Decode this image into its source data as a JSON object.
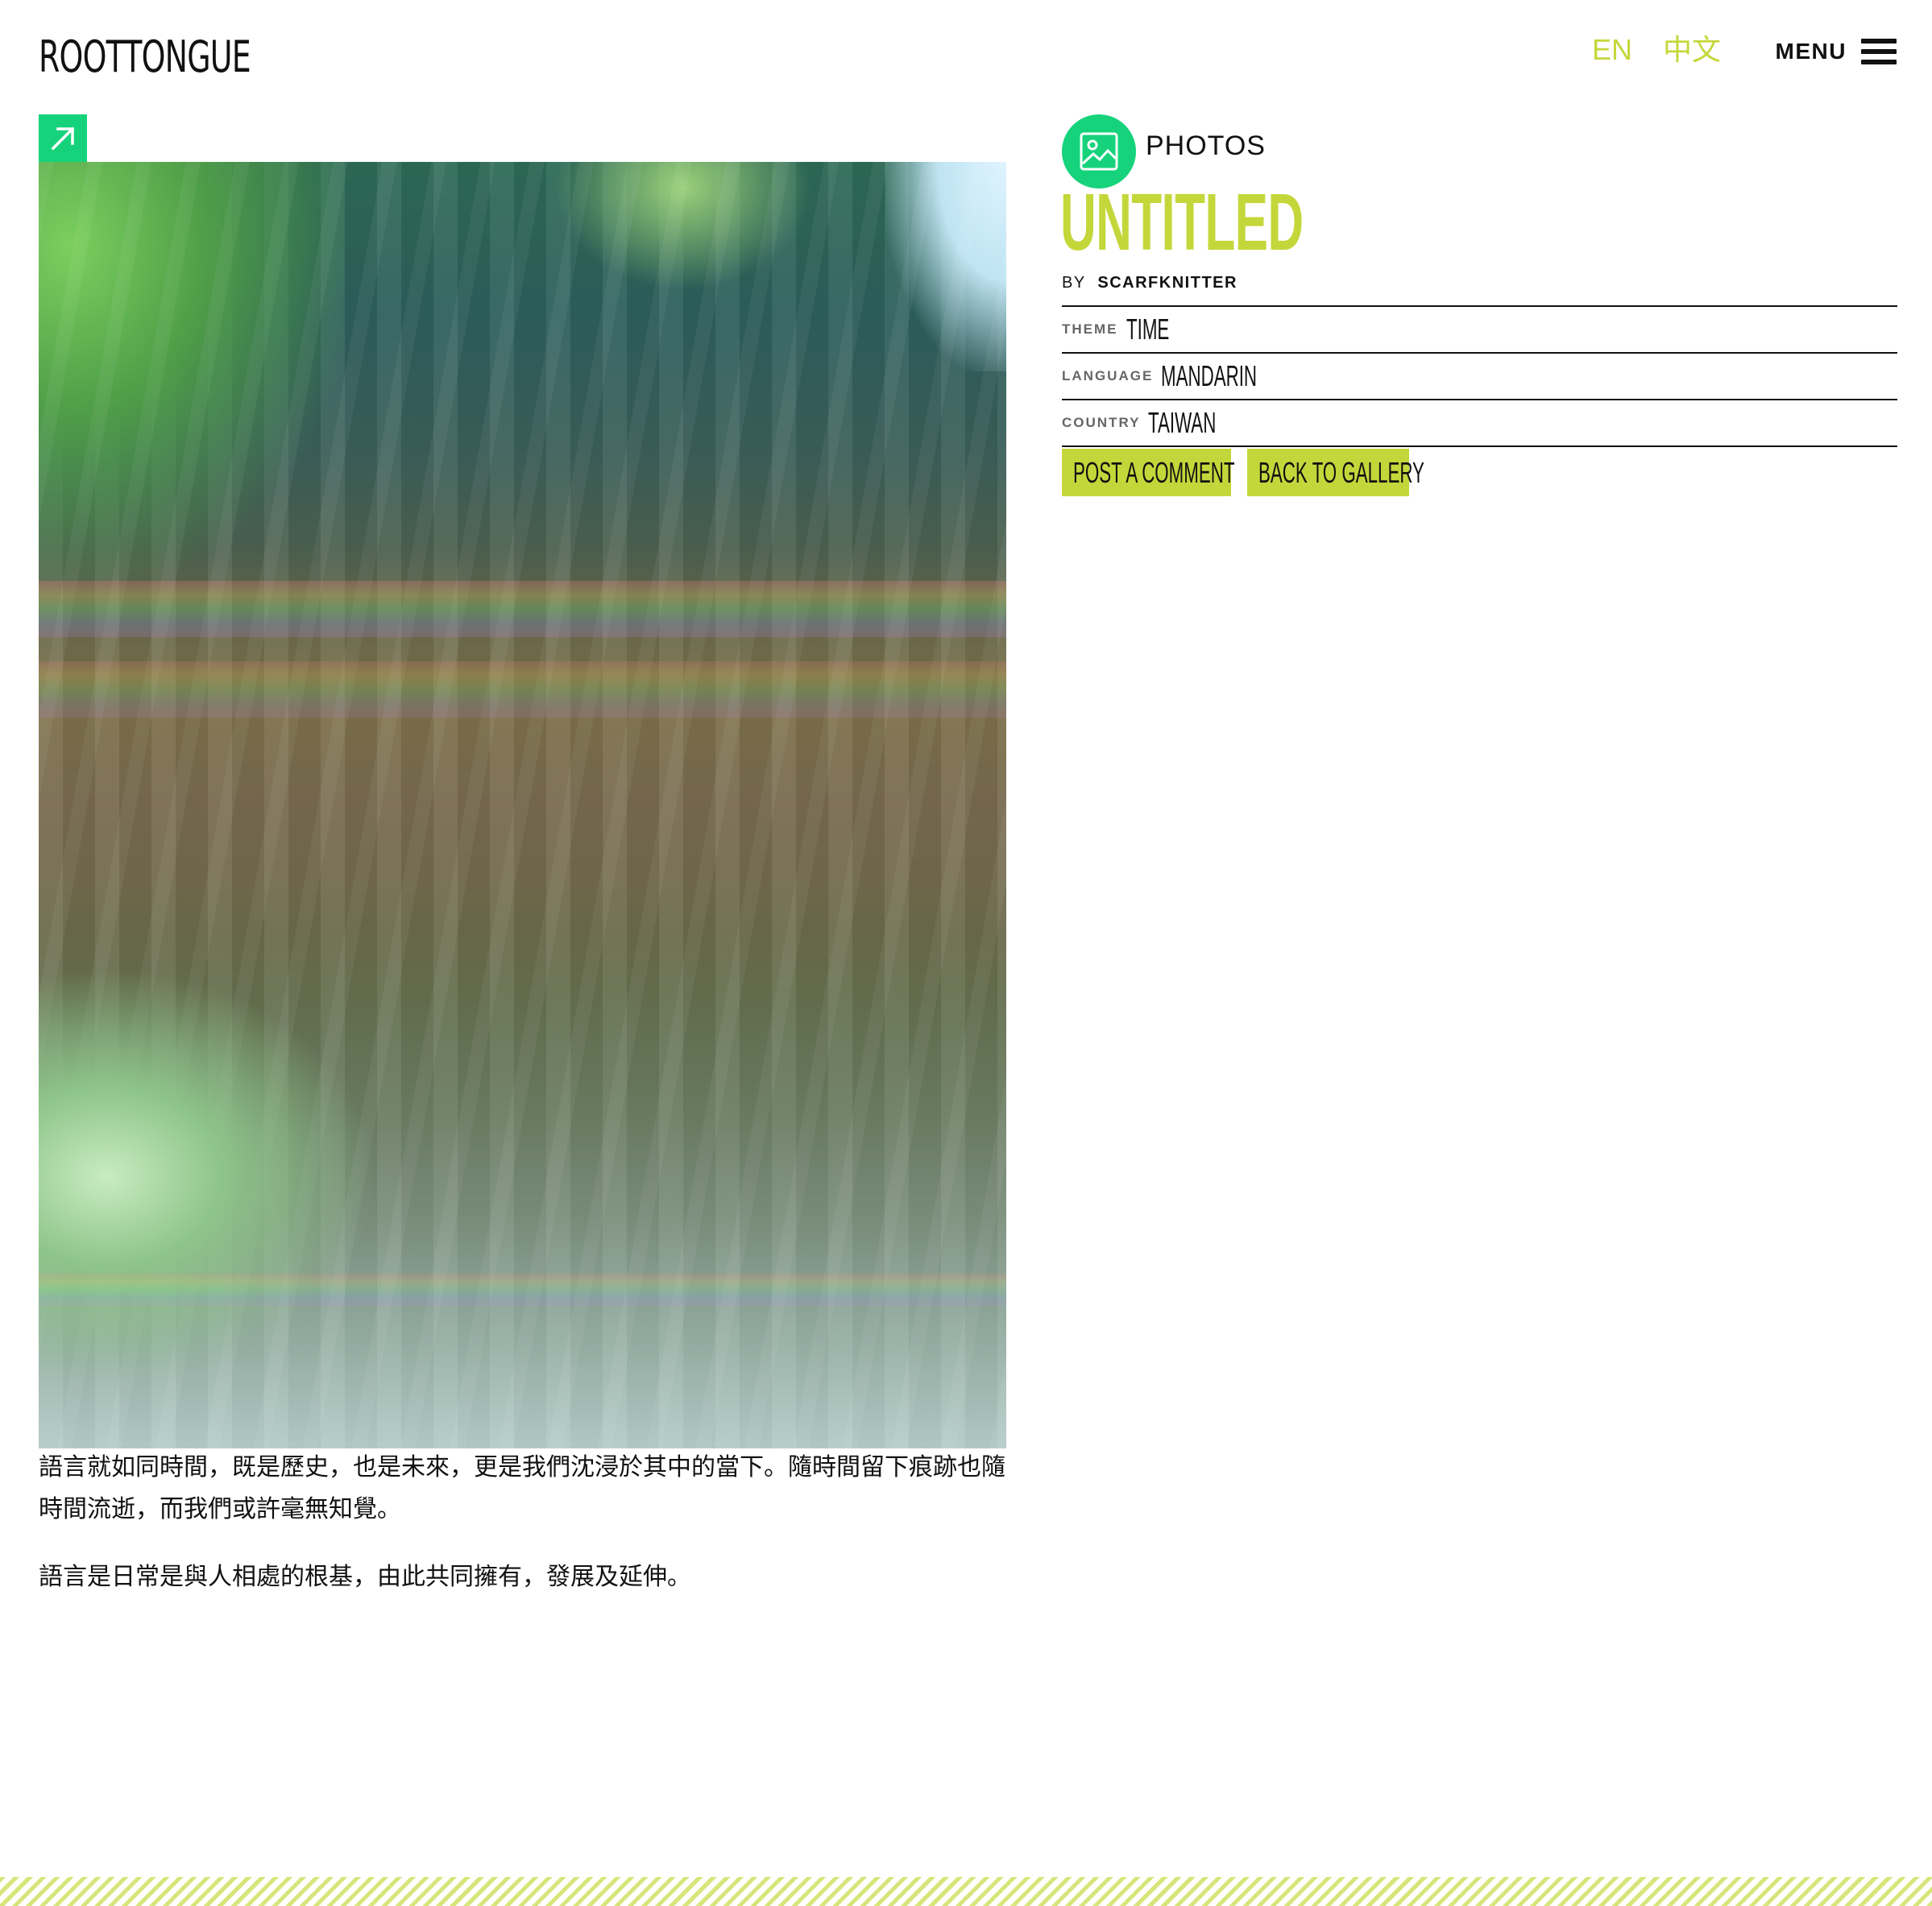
{
  "header": {
    "logo": "ROOTTONGUE",
    "languages": [
      "EN",
      "中文"
    ],
    "menu_label": "MENU"
  },
  "media": {
    "type_label": "PHOTOS",
    "type_icon": "image-icon",
    "expand_icon": "arrow-up-right-icon"
  },
  "entry": {
    "title": "UNTITLED",
    "by_label": "BY",
    "author": "SCARFKNITTER",
    "meta": [
      {
        "key": "THEME",
        "value": "TIME"
      },
      {
        "key": "LANGUAGE",
        "value": "MANDARIN"
      },
      {
        "key": "COUNTRY",
        "value": "TAIWAN"
      }
    ],
    "actions": {
      "comment": "POST A COMMENT",
      "back": "BACK TO GALLERY"
    },
    "caption": [
      "語言就如同時間，既是歷史，也是未來，更是我們沈浸於其中的當下。隨時間留下痕跡也隨時間流逝，而我們或許毫無知覺。",
      "語言是日常是與人相處的根基，由此共同擁有，發展及延伸。"
    ]
  },
  "colors": {
    "accent": "#c4d73a",
    "green": "#16d37b",
    "text": "#111111"
  }
}
